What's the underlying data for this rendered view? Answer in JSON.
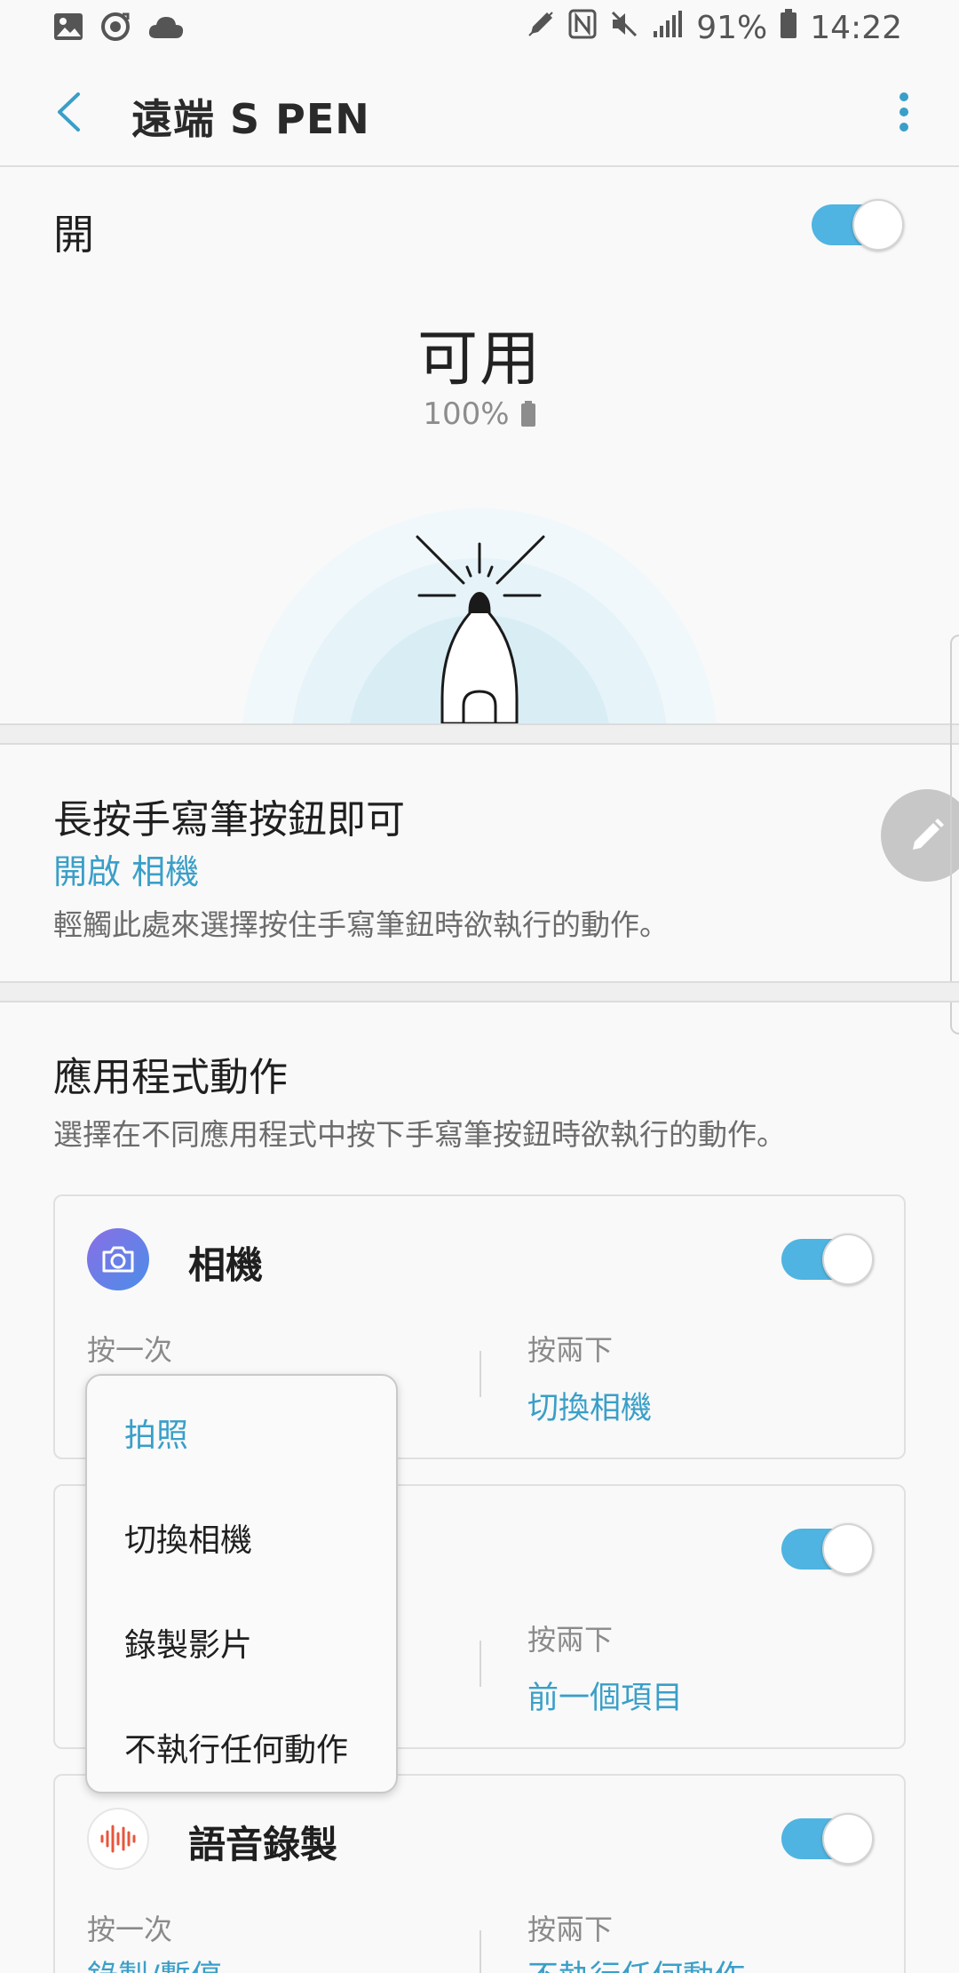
{
  "status_bar": {
    "battery": "91%",
    "time": "14:22"
  },
  "app_bar": {
    "title": "遠端 S PEN"
  },
  "master": {
    "label": "開",
    "state_on": true
  },
  "pen_status": {
    "status": "可用",
    "battery": "100%"
  },
  "long_press": {
    "title": "長按手寫筆按鈕即可",
    "action": "開啟 相機",
    "description": "輕觸此處來選擇按住手寫筆鈕時欲執行的動作。"
  },
  "app_actions": {
    "title": "應用程式動作",
    "description": "選擇在不同應用程式中按下手寫筆按鈕時欲執行的動作。",
    "cards": [
      {
        "name": "相機",
        "enabled": true,
        "single_label": "按一次",
        "single_value": "",
        "double_label": "按兩下",
        "double_value": "切換相機"
      },
      {
        "name": "",
        "enabled": true,
        "single_label": "",
        "single_value": "",
        "double_label": "按兩下",
        "double_value": "前一個項目"
      },
      {
        "name": "語音錄製",
        "enabled": true,
        "single_label": "按一次",
        "single_value": "錄製/暫停",
        "double_label": "按兩下",
        "double_value": "不執行任何動作"
      }
    ]
  },
  "popup_menu": {
    "items": [
      "拍照",
      "切換相機",
      "錄製影片",
      "不執行任何動作"
    ],
    "selected_index": 0
  },
  "colors": {
    "accent": "#3a9fc8",
    "switch_on": "#4fb4e1",
    "background": "#f9f9f9"
  },
  "icons": [
    "gallery-icon",
    "sync-icon",
    "cloud-icon",
    "pen-icon",
    "nfc-icon",
    "mute-icon",
    "signal-icon",
    "battery-icon",
    "back-arrow-icon",
    "more-vert-icon",
    "camera-icon",
    "voice-recorder-icon",
    "edit-icon"
  ]
}
